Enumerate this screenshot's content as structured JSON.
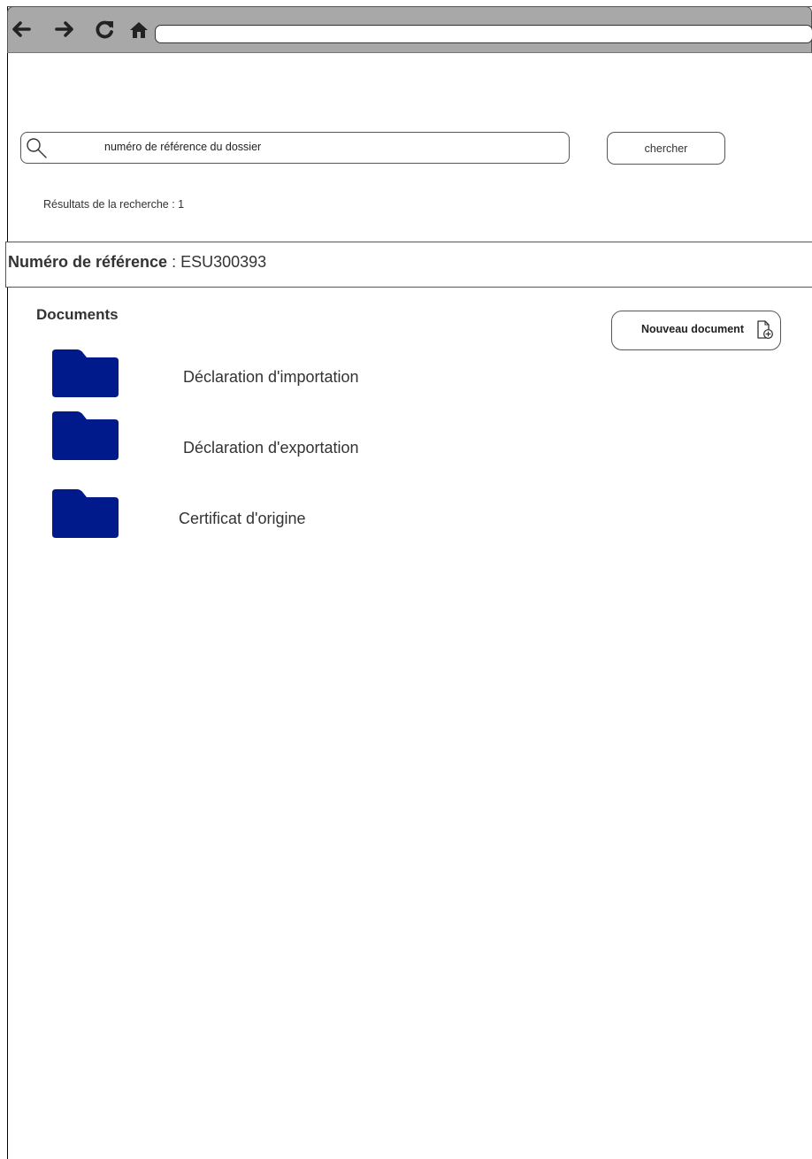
{
  "browser": {
    "icons": [
      "back-arrow-icon",
      "forward-arrow-icon",
      "reload-icon",
      "home-icon"
    ],
    "url": ""
  },
  "search": {
    "icon": "search-icon",
    "placeholder": "numéro de référence du dossier",
    "button_label": "chercher"
  },
  "results": {
    "label": "Résultats de la recherche : 1"
  },
  "record": {
    "reference_label": "Numéro de référence",
    "separator": " : ",
    "reference_value": "ESU300393"
  },
  "documents": {
    "title": "Documents",
    "new_button_label": "Nouveau document",
    "new_button_icon": "new-document-icon",
    "folder_color": "#001a8c",
    "items": [
      {
        "label": "Déclaration d'importation",
        "icon": "folder-icon"
      },
      {
        "label": "Déclaration d'exportation",
        "icon": "folder-icon"
      },
      {
        "label": "Certificat d'origine",
        "icon": "folder-icon"
      }
    ]
  }
}
